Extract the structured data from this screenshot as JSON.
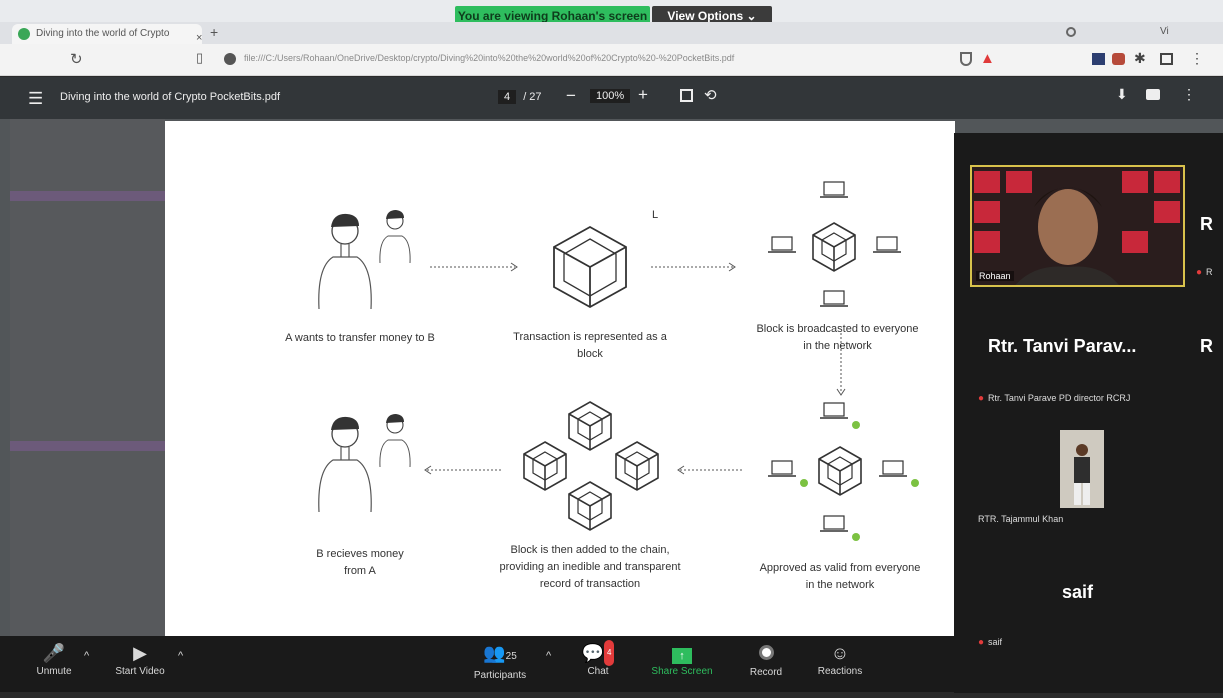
{
  "zoom": {
    "share_banner": "You are viewing Rohaan's screen",
    "view_options": "View Options ⌄",
    "window_title": "Vi"
  },
  "browser": {
    "tab_title": "Diving into the world of Crypto",
    "tab_close": "×",
    "new_tab": "+",
    "url": "file:///C:/Users/Rohaan/OneDrive/Desktop/crypto/Diving%20into%20the%20world%20of%20Crypto%20-%20PocketBits.pdf"
  },
  "pdf": {
    "title": "Diving into the world of Crypto  PocketBits.pdf",
    "page_current": "4",
    "page_total": "/ 27",
    "zoom": "100%"
  },
  "diagram": {
    "step1": "A wants to transfer money to B",
    "step2": "Transaction is represented as a block",
    "step3": "Block is broadcasted to everyone in the network",
    "step4": "Approved as valid from everyone in the network",
    "step5": "Block is then added to the chain, providing an inedible and transparent record of transaction",
    "step6": "B recieves money from A",
    "stray_mark": "L"
  },
  "participants": {
    "video_name": "Rohaan",
    "tanvi_big": "Rtr. Tanvi Parav...",
    "tanvi_small": "Rtr. Tanvi Parave PD director RCRJ",
    "tajammul_small": "RTR. Tajammul Khan",
    "saif_big": "saif",
    "saif_small": "saif",
    "edge_big_1": "R",
    "edge_big_2": "R",
    "edge_small": "R"
  },
  "controls": {
    "unmute": "Unmute",
    "start_video": "Start Video",
    "participants": "Participants",
    "participants_count": "25",
    "chat": "Chat",
    "chat_badge": "4",
    "share_screen": "Share Screen",
    "record": "Record",
    "reactions": "Reactions"
  },
  "colors": {
    "zoom_green": "#2ebd5e",
    "pdf_toolbar": "#323639",
    "active_speaker": "#d8c24c",
    "mic_red": "#e23b3b"
  }
}
